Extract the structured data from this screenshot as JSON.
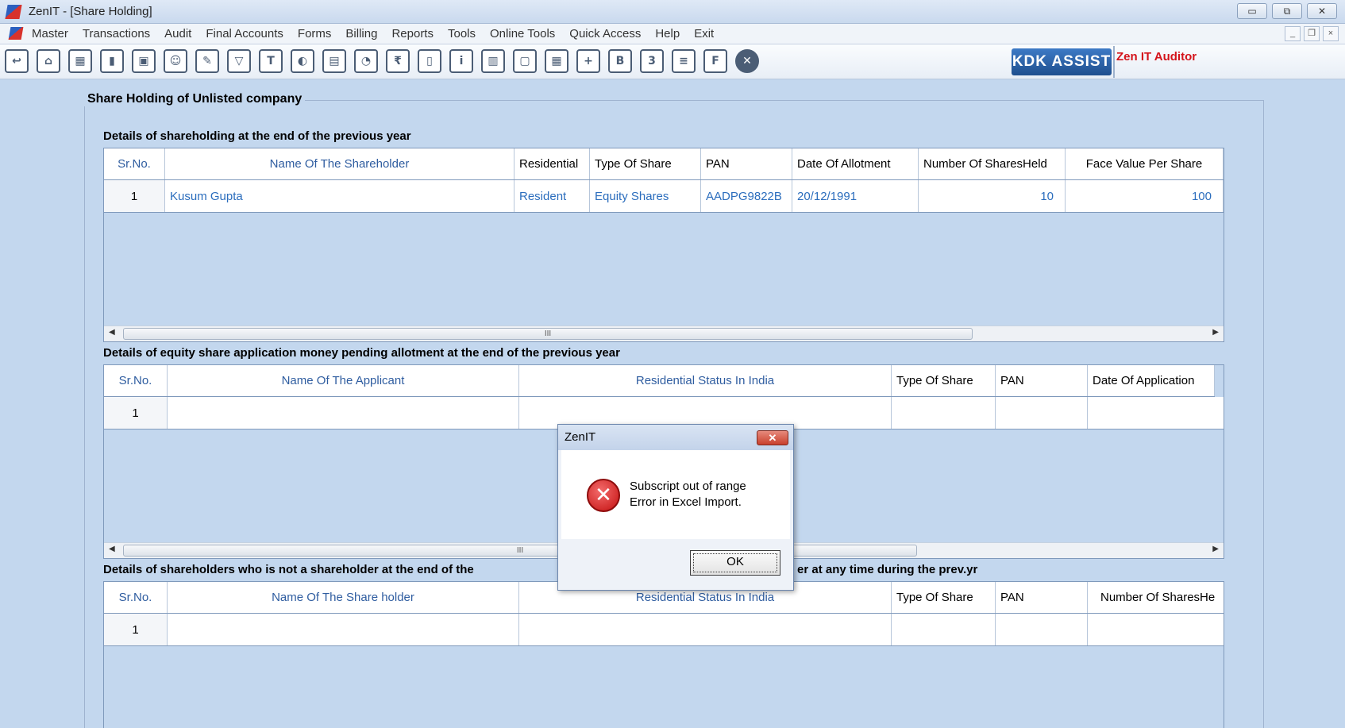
{
  "window": {
    "title": "ZenIT - [Share Holding]",
    "controls": [
      "▭",
      "⧉",
      "✕"
    ]
  },
  "menu": {
    "items": [
      "Master",
      "Transactions",
      "Audit",
      "Final Accounts",
      "Forms",
      "Billing",
      "Reports",
      "Tools",
      "Online Tools",
      "Quick Access",
      "Help",
      "Exit"
    ],
    "mdi_controls": [
      "_",
      "❐",
      "×"
    ]
  },
  "toolbar": {
    "icons": [
      "back-icon",
      "home-icon",
      "building-icon",
      "bar-chart-icon",
      "gift-icon",
      "users-icon",
      "edit-icon",
      "filter-icon",
      "tax-icon",
      "toggle-icon",
      "calculator-icon",
      "pie-chart-icon",
      "pay-icon",
      "book-icon",
      "info-icon",
      "report-icon",
      "document-icon",
      "calendar-icon",
      "add-icon",
      "bs-icon",
      "3cd-icon",
      "ledger-icon",
      "fac-icon",
      "close-icon"
    ],
    "kdk_label": "KDK ASSIST",
    "auditor_label": "Zen IT Auditor"
  },
  "form": {
    "group_title": "Share Holding of Unlisted company",
    "section1": {
      "label": "Details of shareholding at the end of the previous year",
      "headers": [
        "Sr.No.",
        "Name Of The Shareholder",
        "Residential",
        "Type Of Share",
        "PAN",
        "Date Of Allotment",
        "Number Of SharesHeld",
        "Face Value Per Share"
      ],
      "row": [
        "1",
        "Kusum Gupta",
        "Resident",
        "Equity Shares",
        "AADPG9822B",
        "20/12/1991",
        "10",
        "100"
      ]
    },
    "section2": {
      "label": "Details of equity share application money pending allotment at the end of the previous year",
      "headers": [
        "Sr.No.",
        "Name Of The Applicant",
        "Residential Status In India",
        "Type Of Share",
        "PAN",
        "Date Of Application"
      ],
      "row_no": "1"
    },
    "section3": {
      "label_left": "Details of shareholders who is not a shareholder at the end of the",
      "label_right": "er at any time during the prev.yr",
      "headers": [
        "Sr.No.",
        "Name Of The Share holder",
        "Residential Status In India",
        "Type Of Share",
        "PAN",
        "Number Of SharesHe"
      ],
      "row_no": "1"
    },
    "scroll_thumb": "III"
  },
  "dialog": {
    "title": "ZenIT",
    "close": "✕",
    "line1": "Subscript out of range",
    "line2": "Error in Excel Import.",
    "ok": "OK"
  }
}
